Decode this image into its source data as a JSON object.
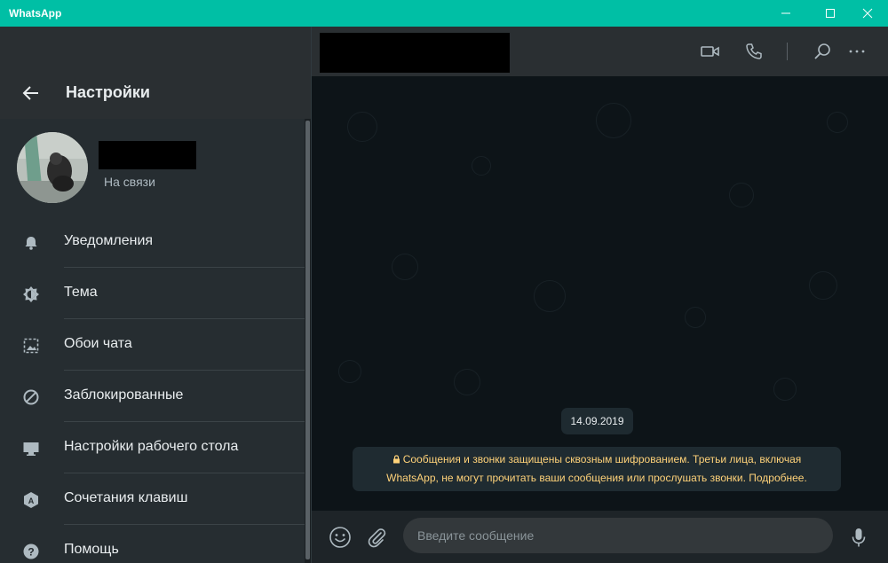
{
  "window": {
    "title": "WhatsApp",
    "controls": [
      "minimize",
      "maximize",
      "close"
    ]
  },
  "settings": {
    "title": "Настройки",
    "profile": {
      "status": "На связи"
    },
    "items": [
      {
        "label": "Уведомления",
        "icon": "bell-icon"
      },
      {
        "label": "Тема",
        "icon": "theme-icon"
      },
      {
        "label": "Обои чата",
        "icon": "wallpaper-icon"
      },
      {
        "label": "Заблокированные",
        "icon": "blocked-icon"
      },
      {
        "label": "Настройки рабочего стола",
        "icon": "desktop-icon"
      },
      {
        "label": "Сочетания клавиш",
        "icon": "keyboard-shortcuts-icon"
      },
      {
        "label": "Помощь",
        "icon": "help-icon"
      }
    ]
  },
  "chat": {
    "header_icons": [
      "video-call-icon",
      "voice-call-icon",
      "search-icon",
      "more-icon"
    ],
    "date_chip": "14.09.2019",
    "encryption_note_line1": "Сообщения и звонки защищены сквозным шифрованием. Третьи лица, включая",
    "encryption_note_line2": "WhatsApp, не могут прочитать ваши сообщения или прослушать звонки. Подробнее.",
    "composer": {
      "placeholder": "Введите сообщение"
    }
  },
  "colors": {
    "titlebar": "#00bfa5",
    "panel": "#262d31",
    "chat_bg": "#0d1418",
    "note_text": "#ffd279"
  }
}
